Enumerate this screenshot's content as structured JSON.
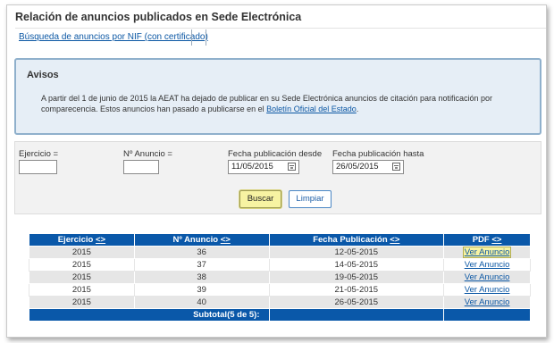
{
  "page": {
    "title": "Relación de anuncios publicados en Sede Electrónica",
    "nav_link": "Búsqueda de anuncios por NIF (con certificado)"
  },
  "avisos": {
    "title": "Avisos",
    "text_before": "A partir del 1 de junio de 2015 la AEAT ha dejado de publicar en su Sede Electrónica anuncios de citación para notificación por comparecencia. Estos anuncios han pasado a publicarse en el ",
    "link": "Boletín Oficial del Estado",
    "text_after": "."
  },
  "filters": {
    "ejercicio_label": "Ejercicio =",
    "ejercicio_value": "",
    "anuncio_label": "Nº Anuncio =",
    "anuncio_value": "",
    "desde_label": "Fecha publicación desde",
    "desde_value": "11/05/2015",
    "hasta_label": "Fecha publicación hasta",
    "hasta_value": "26/05/2015",
    "buscar": "Buscar",
    "limpiar": "Limpiar"
  },
  "table": {
    "headers": [
      "Ejercicio",
      "Nº Anuncio",
      "Fecha Publicación",
      "PDF"
    ],
    "sort_glyph": "<>",
    "rows": [
      {
        "ejercicio": "2015",
        "anuncio": "36",
        "fecha": "12-05-2015",
        "pdf": "Ver Anuncio"
      },
      {
        "ejercicio": "2015",
        "anuncio": "37",
        "fecha": "14-05-2015",
        "pdf": "Ver Anuncio"
      },
      {
        "ejercicio": "2015",
        "anuncio": "38",
        "fecha": "19-05-2015",
        "pdf": "Ver Anuncio"
      },
      {
        "ejercicio": "2015",
        "anuncio": "39",
        "fecha": "21-05-2015",
        "pdf": "Ver Anuncio"
      },
      {
        "ejercicio": "2015",
        "anuncio": "40",
        "fecha": "26-05-2015",
        "pdf": "Ver Anuncio"
      }
    ],
    "subtotal": "Subtotal(5 de 5):"
  },
  "colors": {
    "header_blue": "#0a58a9",
    "link_blue": "#0b57a4",
    "avisos_bg": "#e6eef6",
    "highlight": "#f7f3a2"
  }
}
